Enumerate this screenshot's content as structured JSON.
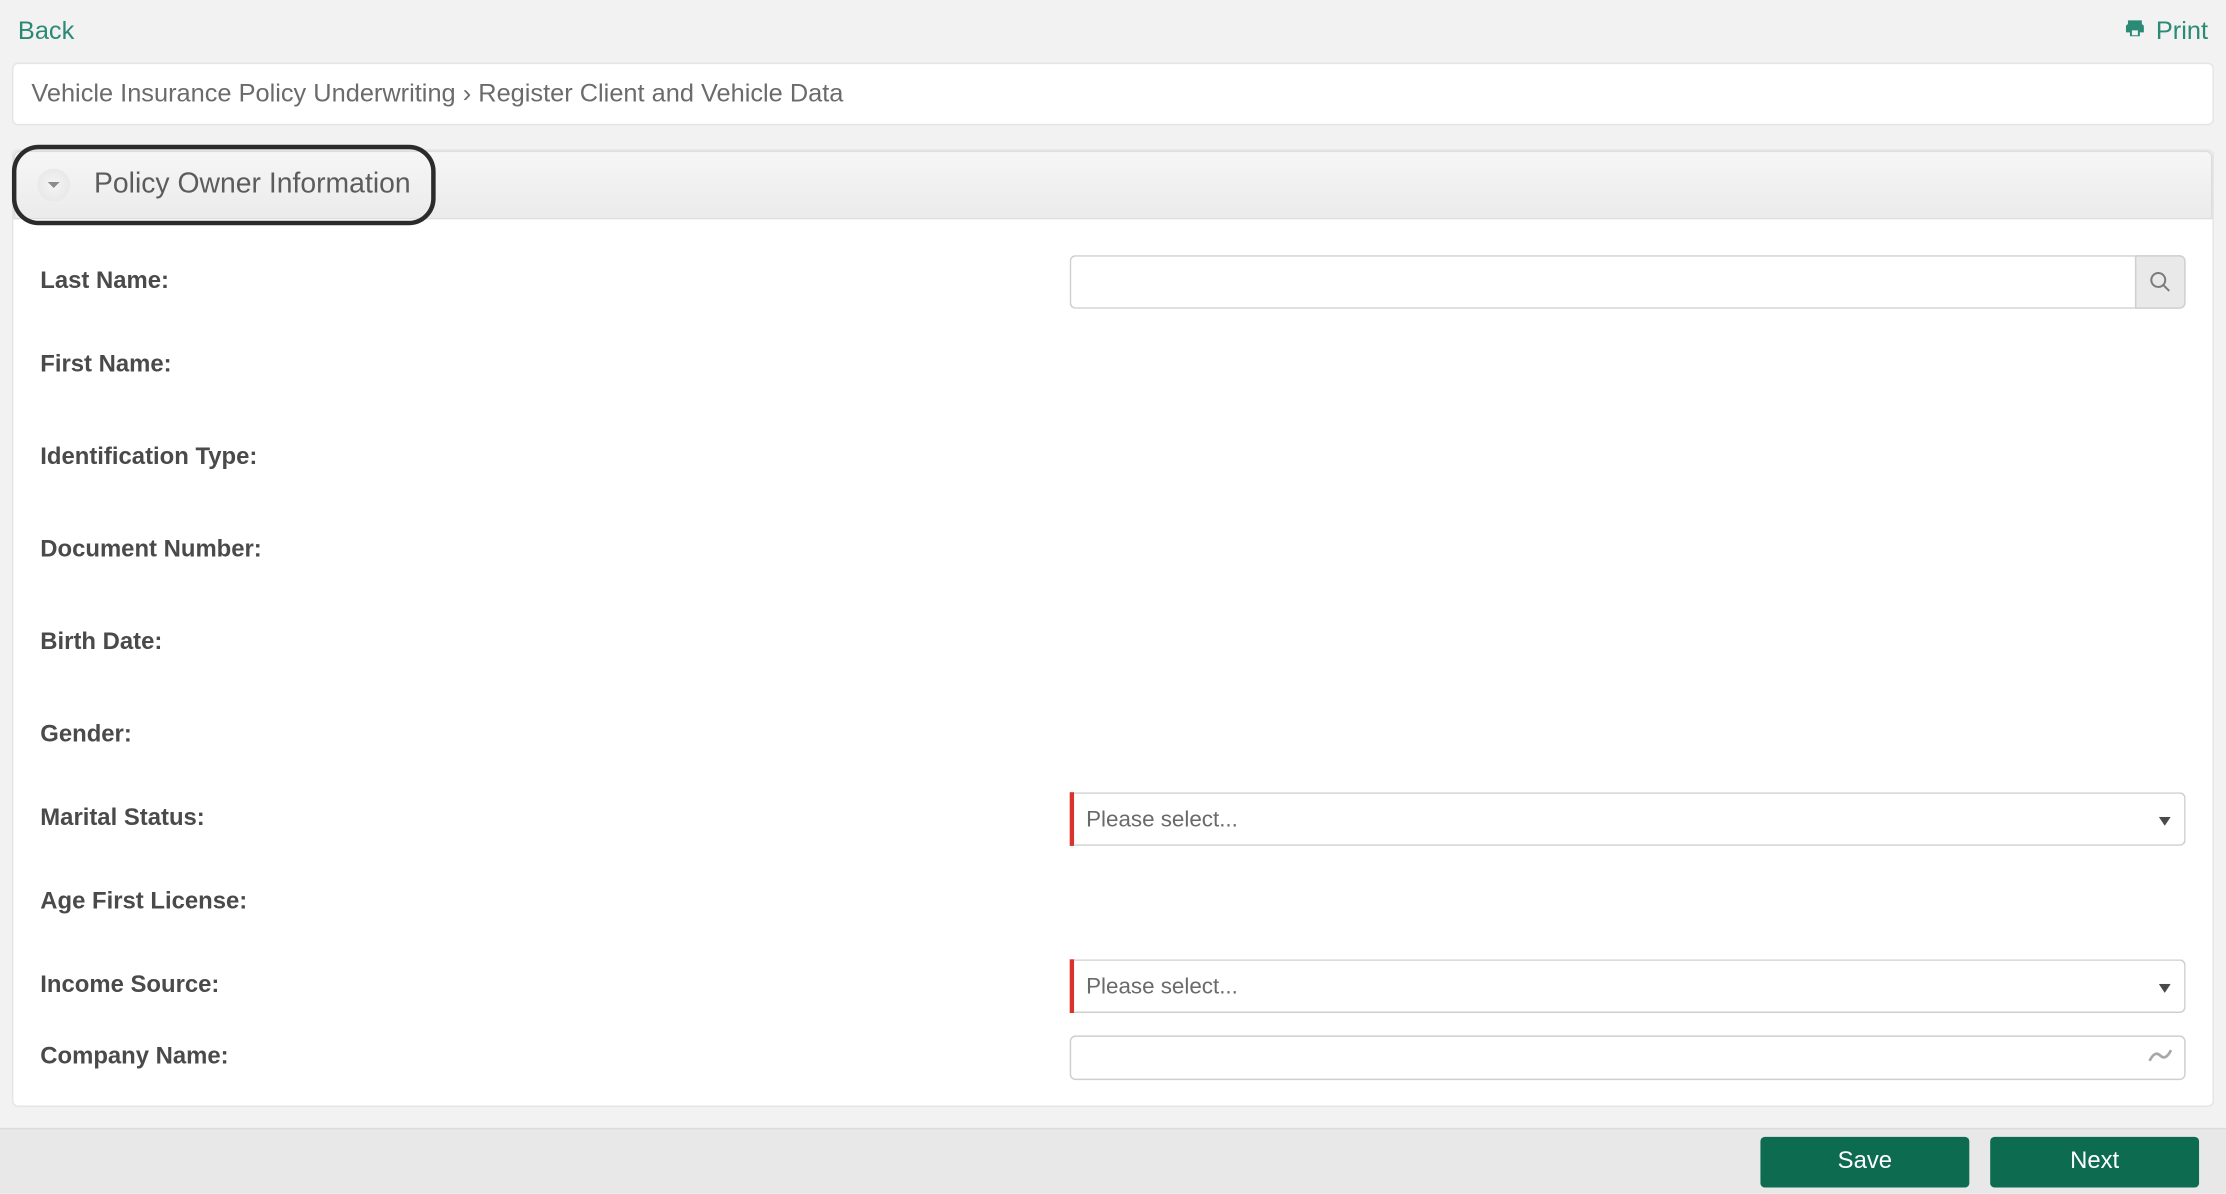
{
  "topbar": {
    "back_label": "Back",
    "print_label": "Print"
  },
  "breadcrumb": {
    "path1": "Vehicle Insurance Policy Underwriting",
    "separator": "›",
    "path2": "Register Client and Vehicle Data"
  },
  "section": {
    "title": "Policy Owner Information"
  },
  "labels": {
    "last_name": "Last Name:",
    "first_name": "First Name:",
    "identification_type": "Identification Type:",
    "document_number": "Document Number:",
    "birth_date": "Birth Date:",
    "gender": "Gender:",
    "marital_status": "Marital Status:",
    "age_first_license": "Age First License:",
    "income_source": "Income Source:",
    "company_name": "Company Name:"
  },
  "placeholders": {
    "please_select": "Please select..."
  },
  "footer": {
    "save": "Save",
    "next": "Next"
  }
}
